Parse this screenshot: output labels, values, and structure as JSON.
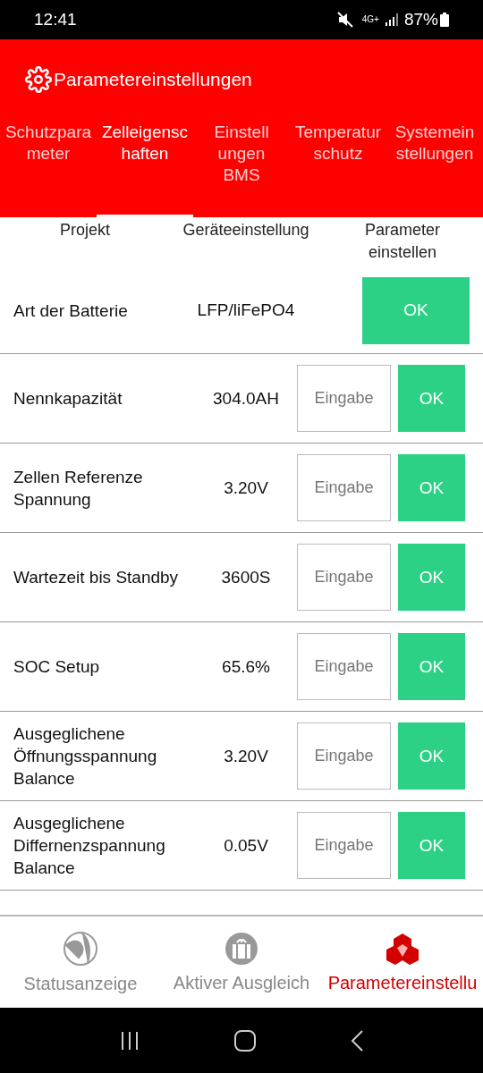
{
  "status_bar": {
    "time": "12:41",
    "network": "4G+",
    "battery": "87%"
  },
  "header": {
    "title": "Parametereinstellungen"
  },
  "tabs": [
    {
      "label": "Schutzpara\nmeter",
      "selected": false
    },
    {
      "label": "Zelleigensc\nhaften",
      "selected": true
    },
    {
      "label": "Einstell\nungen\nBMS",
      "selected": false
    },
    {
      "label": "Temperatur\nschutz",
      "selected": false
    },
    {
      "label": "Systemein\nstellungen",
      "selected": false
    }
  ],
  "table": {
    "columns": [
      "Projekt",
      "Geräteeinstellung",
      "Parameter\neinstellen"
    ],
    "rows": [
      {
        "kind": "fixed",
        "name": "Art der Batterie",
        "value": "LFP/liFePO4",
        "button": "OK"
      },
      {
        "kind": "input",
        "name": "Nennkapazität",
        "value": "304.0AH",
        "placeholder": "Eingabe",
        "button": "OK"
      },
      {
        "kind": "input",
        "name": "Zellen Referenze\nSpannung",
        "value": "3.20V",
        "placeholder": "Eingabe",
        "button": "OK"
      },
      {
        "kind": "input",
        "name": "Wartezeit bis Standby",
        "value": "3600S",
        "placeholder": "Eingabe",
        "button": "OK"
      },
      {
        "kind": "input",
        "name": "SOC Setup",
        "value": "65.6%",
        "placeholder": "Eingabe",
        "button": "OK"
      },
      {
        "kind": "input",
        "name": "Ausgeglichene\nÖffnungsspannung\nBalance",
        "value": "3.20V",
        "placeholder": "Eingabe",
        "button": "OK"
      },
      {
        "kind": "input",
        "name": "Ausgeglichene\nDiffernenzspannung\nBalance",
        "value": "0.05V",
        "placeholder": "Eingabe",
        "button": "OK"
      }
    ]
  },
  "bottom_nav": [
    {
      "kind": "globe",
      "label": "Statusanzeige",
      "selected": false
    },
    {
      "kind": "gift",
      "label": "Aktiver Ausgleich",
      "selected": false
    },
    {
      "kind": "cubes",
      "label": "Parametereinstellu",
      "selected": true
    }
  ]
}
